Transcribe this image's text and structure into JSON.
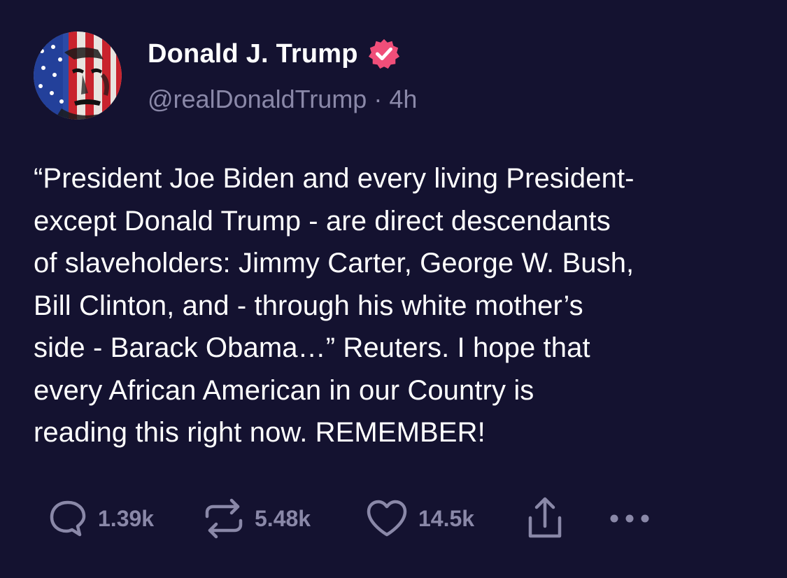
{
  "author": {
    "display_name": "Donald J. Trump",
    "handle": "@realDonaldTrump",
    "separator": "·",
    "time": "4h",
    "avatar_icon": "flag-face-avatar",
    "verified_icon": "verified-badge-icon",
    "verified_color": "#f04e79"
  },
  "post": {
    "text": "“President Joe Biden and every living President-\nexcept Donald Trump - are direct descendants\nof slaveholders: Jimmy Carter, George W. Bush,\nBill Clinton, and - through his white mother’s\nside - Barack Obama…” Reuters. I hope that\nevery African American in our Country is\nreading this right now. REMEMBER!"
  },
  "actions": {
    "replies": {
      "icon": "reply-bubble-icon",
      "count": "1.39k"
    },
    "reposts": {
      "icon": "repost-icon",
      "count": "5.48k"
    },
    "likes": {
      "icon": "heart-icon",
      "count": "14.5k"
    },
    "share": {
      "icon": "share-icon"
    },
    "more": {
      "icon": "more-dots-icon"
    }
  },
  "colors": {
    "background": "#141230",
    "text": "#ffffff",
    "muted": "#8a88a8"
  }
}
